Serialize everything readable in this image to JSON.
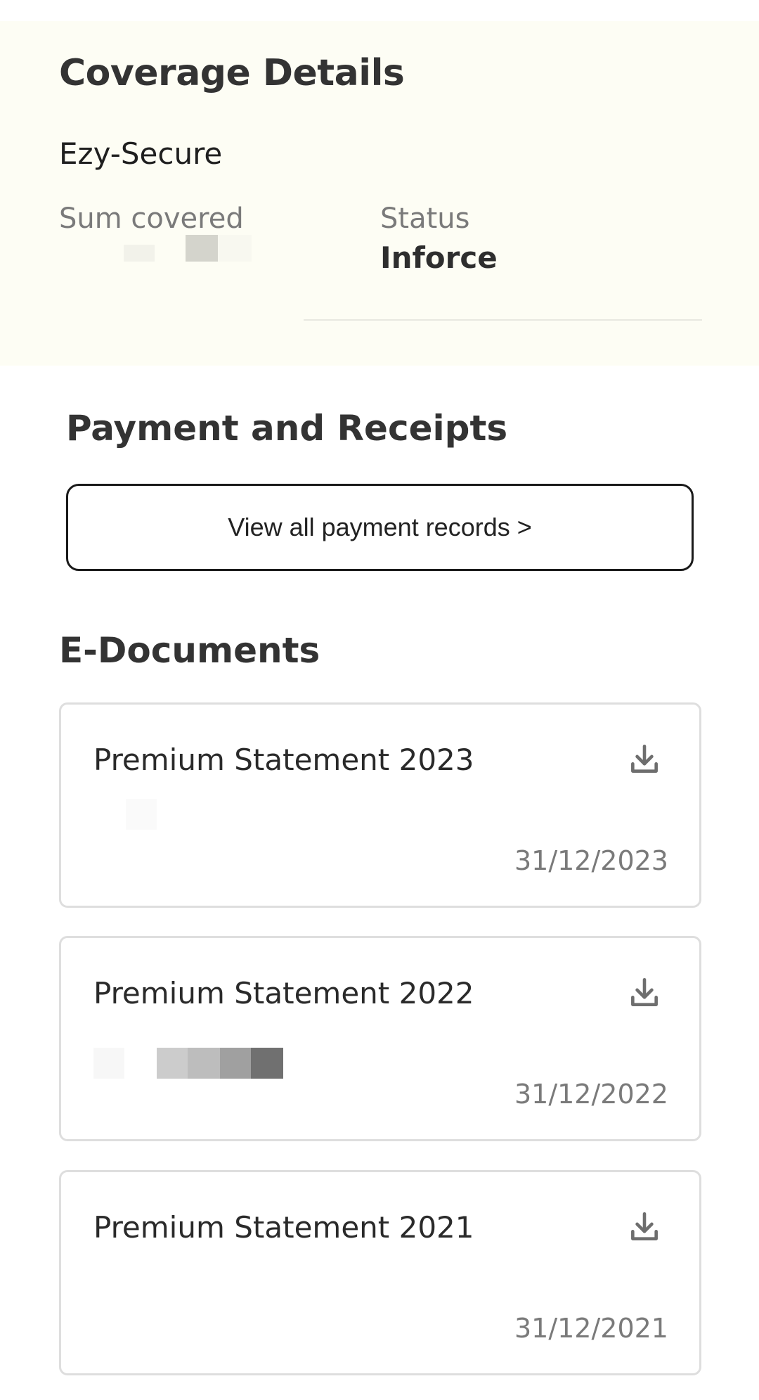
{
  "coverage": {
    "title": "Coverage Details",
    "plan_name": "Ezy-Secure",
    "sum_label": "Sum covered",
    "status_label": "Status",
    "status_value": "Inforce"
  },
  "payment": {
    "title": "Payment and Receipts",
    "button_label": "View all payment records >"
  },
  "edocuments": {
    "title": "E-Documents",
    "items": [
      {
        "name": "Premium Statement 2023",
        "date": "31/12/2023",
        "icon": "download-icon"
      },
      {
        "name": "Premium Statement 2022",
        "date": "31/12/2022",
        "icon": "download-icon"
      },
      {
        "name": "Premium Statement 2021",
        "date": "31/12/2021",
        "icon": "download-icon"
      }
    ]
  },
  "colors": {
    "coverage_bg": "#fdfdf4",
    "text_primary": "#333333",
    "text_secondary": "#7a7a7a",
    "card_border": "#dedede"
  }
}
